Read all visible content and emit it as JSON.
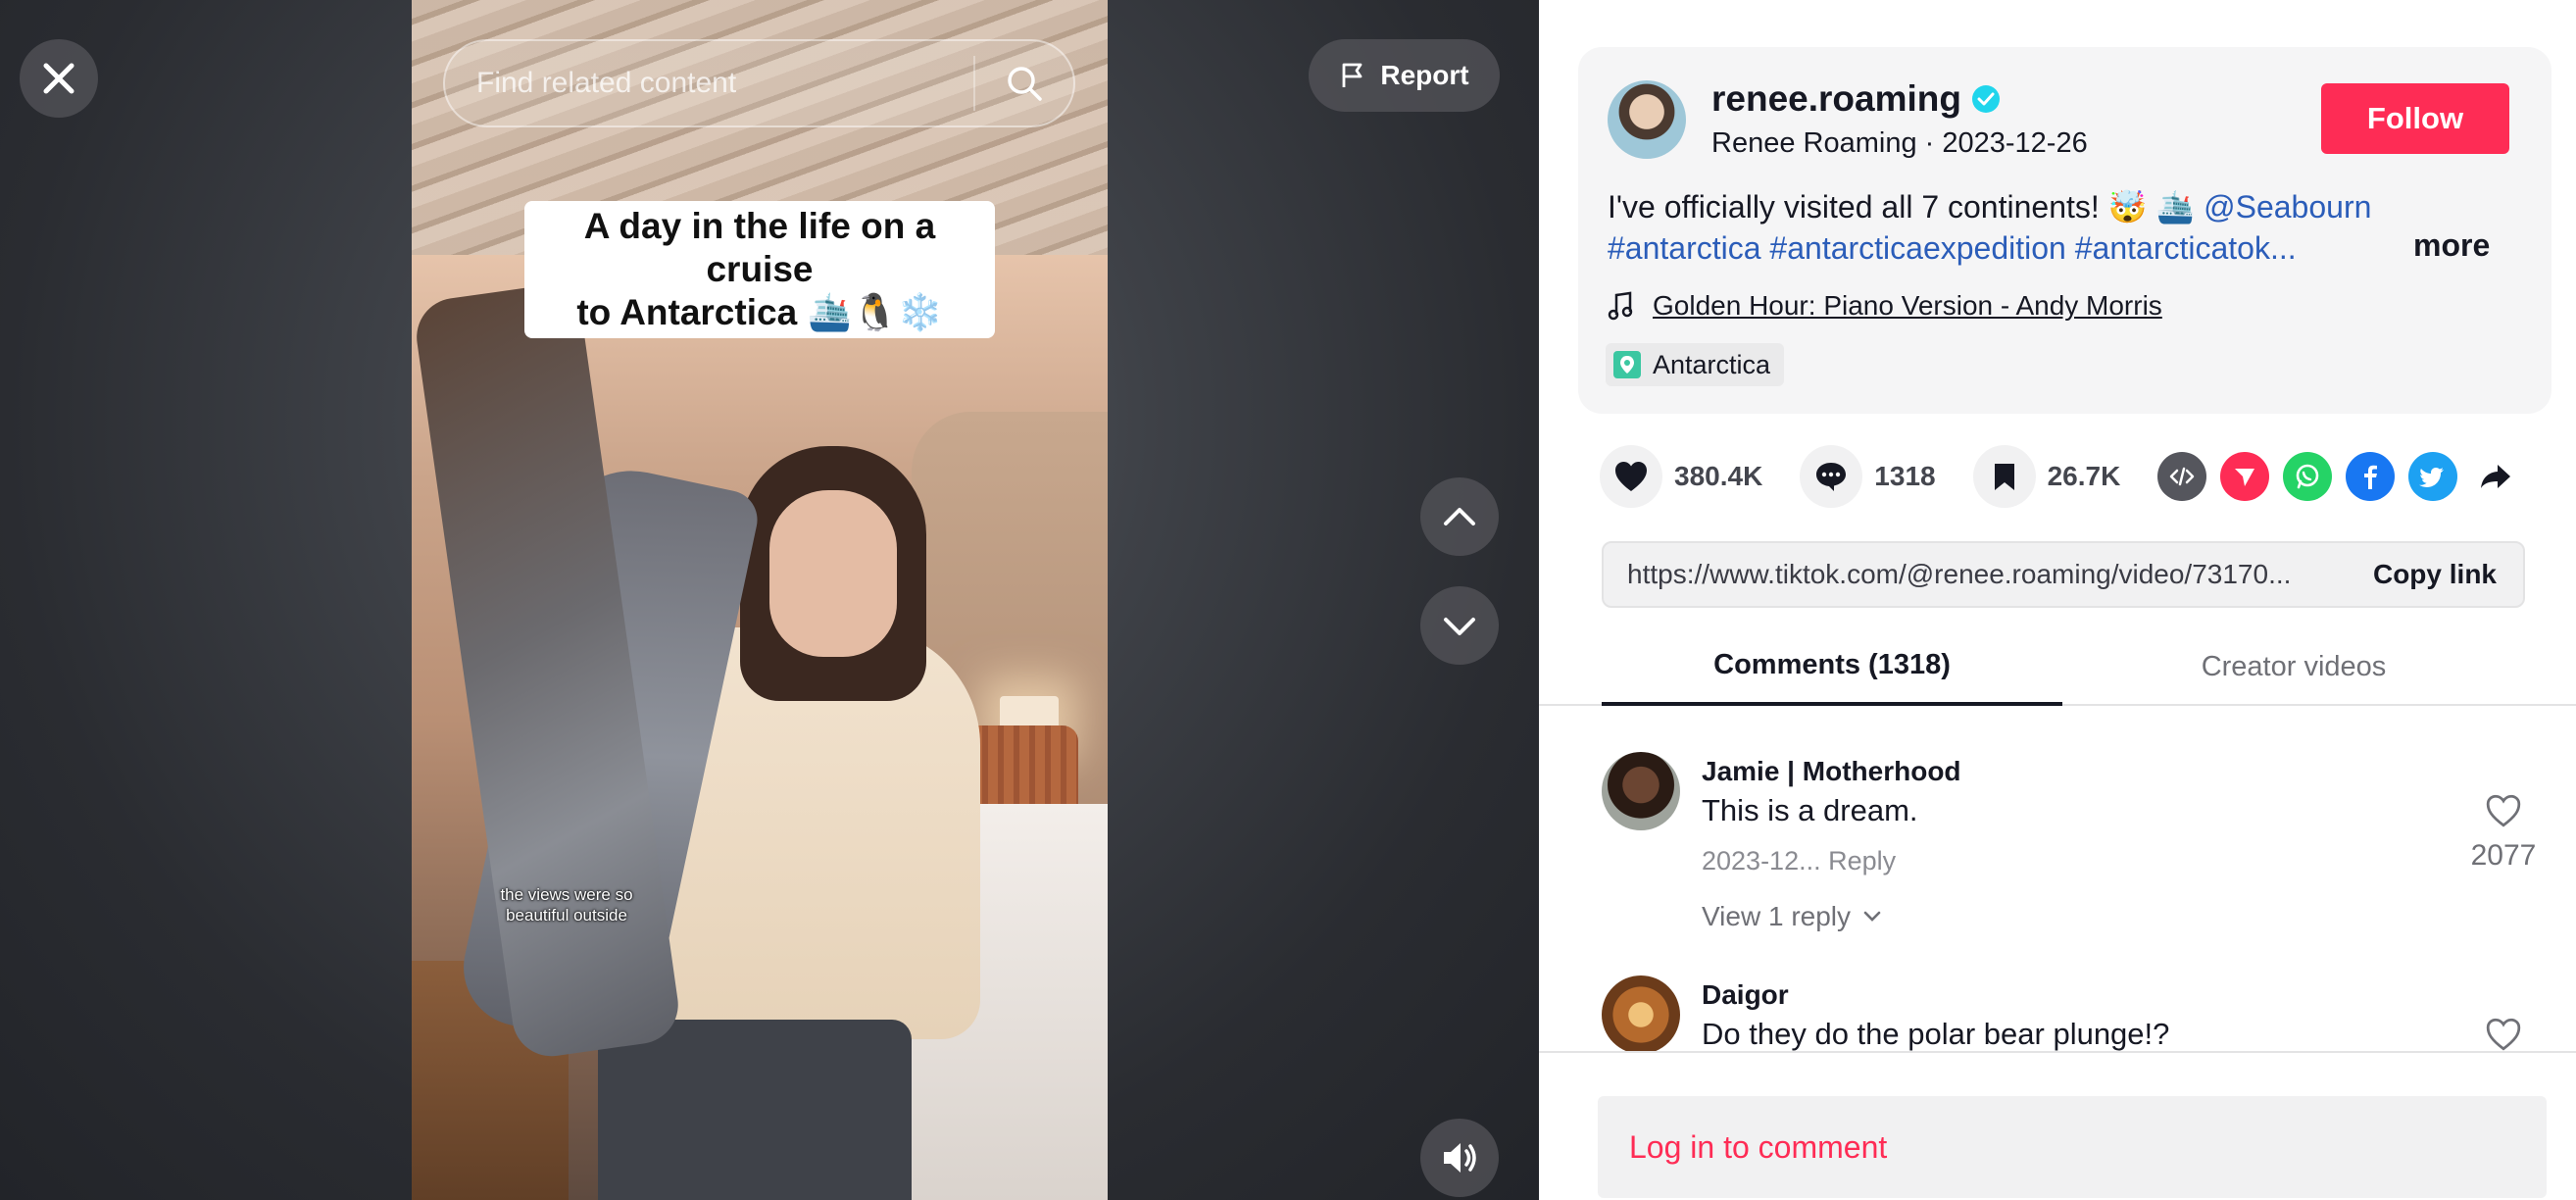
{
  "video": {
    "search_placeholder": "Find related content",
    "report_label": "Report",
    "caption_line1": "A day in the life on a cruise",
    "caption_line2": "to Antarctica 🛳️🐧❄️",
    "subtitle_line1": "the views were so",
    "subtitle_line2": "beautiful outside",
    "icons": {
      "close": "close-icon",
      "search": "search-icon",
      "report": "flag-icon",
      "up": "chevron-up-icon",
      "down": "chevron-down-icon",
      "sound": "speaker-icon"
    }
  },
  "author": {
    "username": "renee.roaming",
    "display_name": "Renee Roaming",
    "date": "2023-12-26",
    "follow_label": "Follow",
    "verified": true
  },
  "description": {
    "text": "I've officially visited all 7 continents! 🤯 🛳️ ",
    "mention": "@Seabourn",
    "hashtags": "#antarctica #antarcticaexpedition #antarcticatok...",
    "more_label": "more"
  },
  "music": {
    "title": "Golden Hour: Piano Version - Andy Morris"
  },
  "location": {
    "name": "Antarctica"
  },
  "stats": {
    "likes": "380.4K",
    "comments": "1318",
    "saves": "26.7K"
  },
  "share_icons": [
    "embed-icon",
    "send-icon",
    "whatsapp-icon",
    "facebook-icon",
    "twitter-icon",
    "share-arrow-icon"
  ],
  "link": {
    "url": "https://www.tiktok.com/@renee.roaming/video/73170...",
    "copy_label": "Copy link"
  },
  "tabs": [
    {
      "label": "Comments (1318)",
      "active": true
    },
    {
      "label": "Creator videos",
      "active": false
    }
  ],
  "comments": [
    {
      "name": "Jamie | Motherhood",
      "text": "This is a dream.",
      "date": "2023-12...",
      "reply_label": "Reply",
      "likes": "2077",
      "view_replies": "View 1 reply"
    },
    {
      "name": "Daigor",
      "text": "Do they do the polar bear plunge!?"
    }
  ],
  "login": {
    "label": "Log in to comment"
  },
  "colors": {
    "accent": "#fe2c55",
    "link": "#2b5db9",
    "verified": "#20d5ec"
  }
}
